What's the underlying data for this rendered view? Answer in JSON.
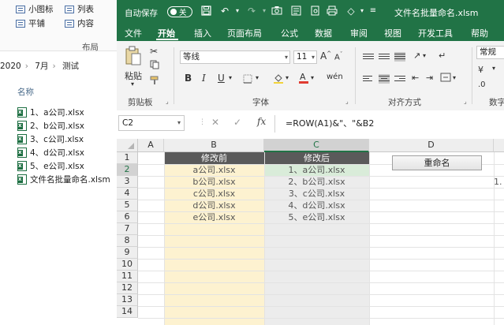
{
  "explorer": {
    "ribbon": {
      "small_icons": "小图标",
      "list": "列表",
      "tiles": "平铺",
      "content": "内容",
      "group_label": "布局"
    },
    "path": [
      "2020",
      "7月",
      "测试"
    ],
    "column_header": "名称",
    "files": [
      "1、a公司.xlsx",
      "2、b公司.xlsx",
      "3、c公司.xlsx",
      "4、d公司.xlsx",
      "5、e公司.xlsx",
      "文件名批量命名.xlsm"
    ]
  },
  "excel": {
    "titlebar": {
      "autosave_label": "自动保存",
      "autosave_state": "关",
      "file_name": "文件名批量命名.xlsm"
    },
    "menu": [
      "文件",
      "开始",
      "插入",
      "页面布局",
      "公式",
      "数据",
      "审阅",
      "视图",
      "开发工具",
      "帮助"
    ],
    "active_menu": "开始",
    "ribbon": {
      "paste_label": "粘贴",
      "clipboard_label": "剪贴板",
      "font_name": "等线",
      "font_size": "11",
      "font_group_label": "字体",
      "align_group_label": "对齐方式",
      "number_format": "常规",
      "number_group_label_partial": "数字",
      "bold": "B",
      "italic": "I",
      "underline": "U",
      "grow_font": "A",
      "shrink_font": "A"
    },
    "formula_bar": {
      "name_box": "C2",
      "formula": "=ROW(A1)&\"、\"&B2",
      "fx": "fx"
    },
    "columns": [
      "A",
      "B",
      "C",
      "D"
    ],
    "rows": [
      "1",
      "2",
      "3",
      "4",
      "5",
      "6",
      "7",
      "8",
      "9",
      "10",
      "11",
      "12",
      "13",
      "14"
    ],
    "header_before": "修改前",
    "header_after": "修改后",
    "before": [
      "a公司.xlsx",
      "b公司.xlsx",
      "c公司.xlsx",
      "d公司.xlsx",
      "e公司.xlsx"
    ],
    "after": [
      "1、a公司.xlsx",
      "2、b公司.xlsx",
      "3、c公司.xlsx",
      "4、d公司.xlsx",
      "5、e公司.xlsx"
    ],
    "rename_button": "重命名",
    "partial_e3": "1.",
    "colors": {
      "excel_green": "#217346",
      "header_fill": "#5a5a5a",
      "before_fill": "#fdf2d0",
      "after_fill": "#ececec",
      "selected_fill": "#d9ecd9"
    }
  }
}
